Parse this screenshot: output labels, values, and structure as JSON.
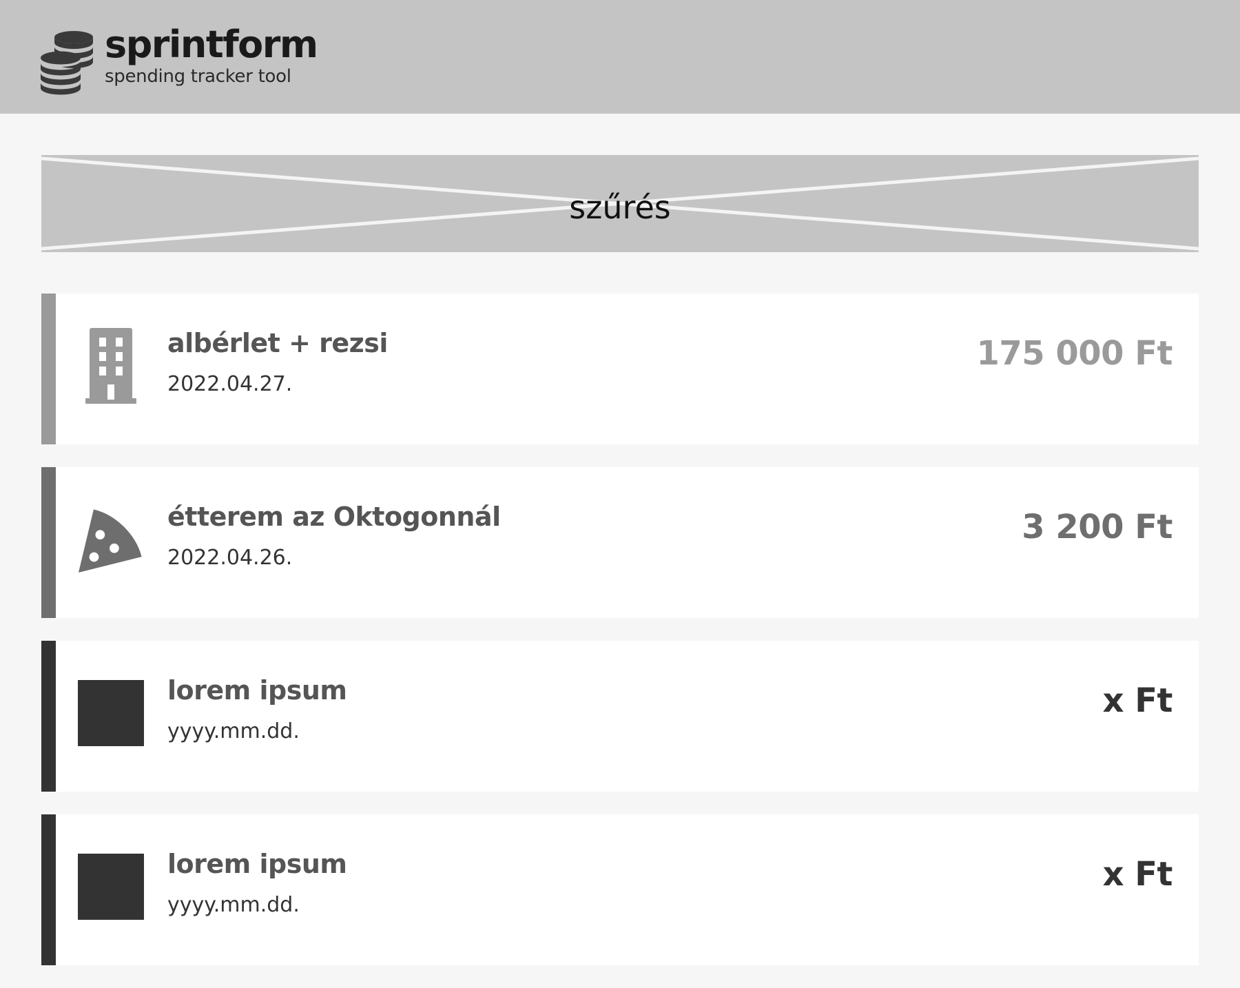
{
  "app": {
    "name": "sprintform",
    "subtitle": "spending tracker tool",
    "logo_icon": "coins-stack-icon"
  },
  "filter": {
    "label": "szűrés"
  },
  "colors": {
    "header_bg": "#c4c4c4",
    "page_bg": "#f6f6f6",
    "card_bg": "#ffffff"
  },
  "expenses": [
    {
      "title": "albérlet + rezsi",
      "date": "2022.04.27.",
      "amount": "175 000 Ft",
      "icon": "building-icon",
      "accent": "#9a9a9a",
      "amount_color": "#9a9a9a"
    },
    {
      "title": "étterem az Oktogonnál",
      "date": "2022.04.26.",
      "amount": "3 200 Ft",
      "icon": "pizza-icon",
      "accent": "#6e6e6e",
      "amount_color": "#6e6e6e"
    },
    {
      "title": "lorem ipsum",
      "date": "yyyy.mm.dd.",
      "amount": "x Ft",
      "icon": "placeholder-square-icon",
      "accent": "#333333",
      "amount_color": "#333333"
    },
    {
      "title": "lorem ipsum",
      "date": "yyyy.mm.dd.",
      "amount": "x Ft",
      "icon": "placeholder-square-icon",
      "accent": "#333333",
      "amount_color": "#333333"
    }
  ]
}
